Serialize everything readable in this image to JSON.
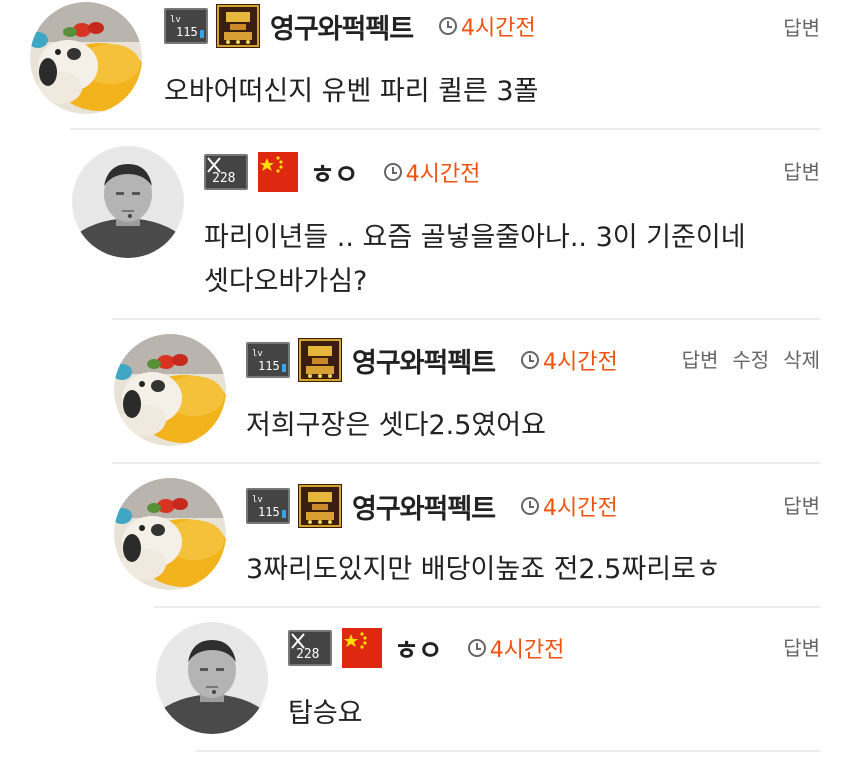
{
  "comments": [
    {
      "nick": "영구와퍽펙트",
      "level": "115",
      "time": "4시간전",
      "text": "오바어떠신지 유벤 파리 퀼른 3폴",
      "actions": [
        "답변"
      ]
    },
    {
      "nick": "ㅎㅇ",
      "level": "228",
      "time": "4시간전",
      "text": "파리이년들 .. 요즘 골넣을줄아나.. 3이 기준이네\n셋다오바가심?",
      "actions": [
        "답변"
      ]
    },
    {
      "nick": "영구와퍽펙트",
      "level": "115",
      "time": "4시간전",
      "text": "저희구장은 셋다2.5였어요",
      "actions": [
        "답변",
        "수정",
        "삭제"
      ]
    },
    {
      "nick": "영구와퍽펙트",
      "level": "115",
      "time": "4시간전",
      "text": "3짜리도있지만 배당이높죠 전2.5짜리로ㅎ",
      "actions": [
        "답변"
      ]
    },
    {
      "nick": "ㅎㅇ",
      "level": "228",
      "time": "4시간전",
      "text": "탑승요",
      "actions": [
        "답변"
      ]
    }
  ],
  "colors": {
    "time": "#f0520f",
    "action": "#666666",
    "separator": "#ececec"
  },
  "icons": {
    "avatar_a": "dog-plush-avatar",
    "avatar_b": "portrait-avatar",
    "badge_a": "trophy-badge-icon",
    "badge_b": "china-flag-icon",
    "clock": "clock-icon"
  }
}
